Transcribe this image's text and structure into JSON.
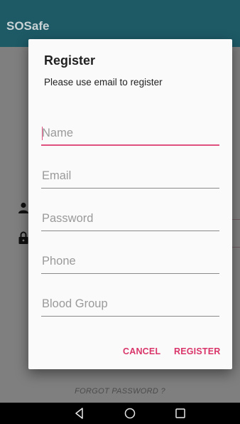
{
  "app": {
    "title": "SOSafe",
    "forgot_password": "FORGOT PASSWORD ?"
  },
  "dialog": {
    "title": "Register",
    "subtitle": "Please use email to register",
    "fields": [
      {
        "placeholder": "Name",
        "value": ""
      },
      {
        "placeholder": "Email",
        "value": ""
      },
      {
        "placeholder": "Password",
        "value": ""
      },
      {
        "placeholder": "Phone",
        "value": ""
      },
      {
        "placeholder": "Blood Group",
        "value": ""
      }
    ],
    "cancel_label": "CANCEL",
    "register_label": "REGISTER"
  },
  "colors": {
    "accent": "#e0507f",
    "app_bar": "#1d5a66",
    "button_text": "#d9356a"
  },
  "icons": [
    "person-icon",
    "lock-icon",
    "back-nav-icon",
    "home-nav-icon",
    "recent-apps-icon"
  ]
}
